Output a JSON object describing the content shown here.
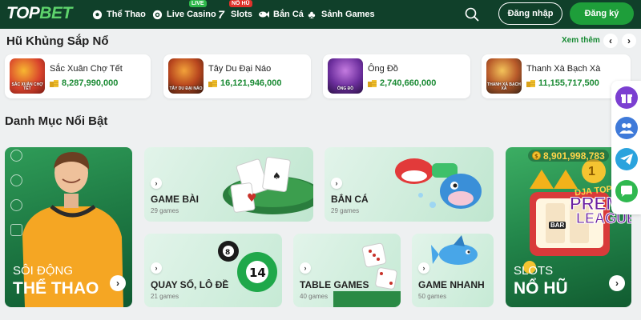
{
  "header": {
    "logo_left": "TOP",
    "logo_right": "BET",
    "nav": [
      {
        "label": "Thể Thao",
        "icon": "soccer-ball-icon",
        "badge": ""
      },
      {
        "label": "Live Casino",
        "icon": "casino-chip-icon",
        "badge": "LIVE"
      },
      {
        "label": "Slots",
        "icon": "lucky-seven-icon",
        "badge": "NỔ HŨ"
      },
      {
        "label": "Bắn Cá",
        "icon": "fish-icon",
        "badge": ""
      },
      {
        "label": "Sảnh Games",
        "icon": "club-card-icon",
        "badge": ""
      }
    ],
    "login_label": "Đăng nhập",
    "register_label": "Đăng ký"
  },
  "jackpot": {
    "title": "Hũ Khủng Sắp Nổ",
    "see_more": "Xem thêm",
    "prev_arrow": "‹",
    "next_arrow": "›",
    "items": [
      {
        "name": "Sắc Xuân Chợ Tết",
        "amount": "8,287,990,000",
        "thumb_text": "SẮC XUÂN CHỢ TẾT"
      },
      {
        "name": "Tây Du Đại Náo",
        "amount": "16,121,946,000",
        "thumb_text": "TÂY DU ĐẠI NÁO"
      },
      {
        "name": "Ông Đồ",
        "amount": "2,740,660,000",
        "thumb_text": "ÔNG ĐỒ"
      },
      {
        "name": "Thanh Xà Bạch Xà",
        "amount": "11,155,717,500",
        "thumb_text": "THANH XÀ BẠCH XÀ"
      }
    ]
  },
  "categories": {
    "title": "Danh Mục Nổi Bật",
    "sports": {
      "line1": "SÔI ĐỘNG",
      "line2": "THỂ THAO",
      "arrow": "›"
    },
    "cards": [
      {
        "label": "GAME BÀI",
        "count": "29 games",
        "arrow": "›"
      },
      {
        "label": "BẮN CÁ",
        "count": "29 games",
        "arrow": "›"
      },
      {
        "label": "QUAY SỐ, LÔ ĐỀ",
        "count": "21 games",
        "arrow": "›"
      },
      {
        "label": "TABLE GAMES",
        "count": "40 games",
        "arrow": "›"
      },
      {
        "label": "GAME NHANH",
        "count": "50 games",
        "arrow": "›"
      }
    ],
    "slots": {
      "line1": "SLOTS",
      "line2": "NỔ HŨ",
      "jackpot": "8,901,998,783",
      "arrow": "›",
      "art_text_1": "DJA TOP",
      "art_text_2": "PREM",
      "art_text_3": "LEAGUE",
      "art_badge": "1",
      "art_bar": "BAR"
    }
  },
  "colors": {
    "header_bg": "#10402a",
    "accent_green": "#1e9e3a",
    "amount_green": "#1a8a33",
    "live_badge": "#2eb84b",
    "nohu_badge": "#e0322b"
  },
  "side_icons": [
    "gift-icon",
    "community-icon",
    "telegram-icon",
    "chat-icon"
  ]
}
